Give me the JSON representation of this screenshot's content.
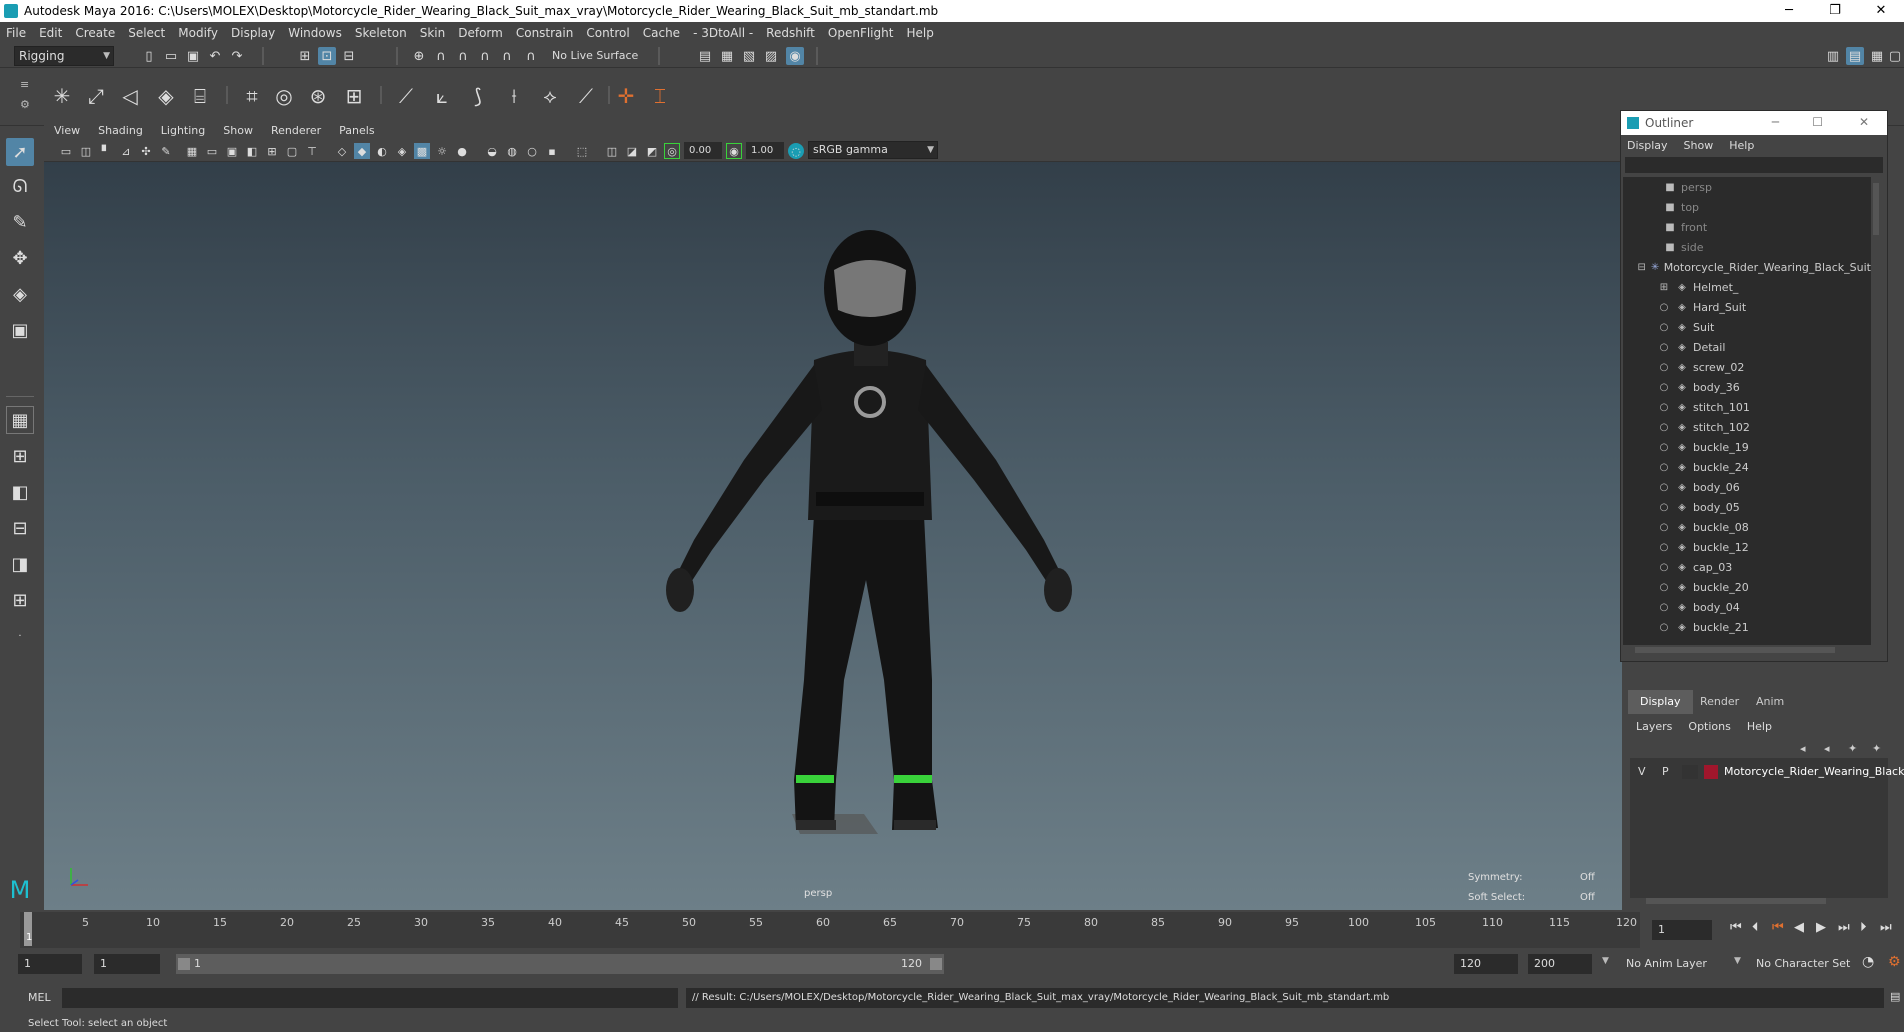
{
  "window": {
    "title": "Autodesk Maya 2016: C:\\Users\\MOLEX\\Desktop\\Motorcycle_Rider_Wearing_Black_Suit_max_vray\\Motorcycle_Rider_Wearing_Black_Suit_mb_standart.mb",
    "minimize": "─",
    "restore": "❐",
    "close": "✕"
  },
  "menubar": [
    "File",
    "Edit",
    "Create",
    "Select",
    "Modify",
    "Display",
    "Windows",
    "Skeleton",
    "Skin",
    "Deform",
    "Constrain",
    "Control",
    "Cache",
    "- 3DtoAll -",
    "Redshift",
    "OpenFlight",
    "Help"
  ],
  "statusline": {
    "menuset": "Rigging",
    "live_surface": "No Live Surface"
  },
  "viewport": {
    "menu": [
      "View",
      "Shading",
      "Lighting",
      "Show",
      "Renderer",
      "Panels"
    ],
    "exposure": "0.00",
    "gamma": "1.00",
    "color_space": "sRGB gamma",
    "camera_label": "persp",
    "symmetry_label": "Symmetry:",
    "symmetry_value": "Off",
    "soft_select_label": "Soft Select:",
    "soft_select_value": "Off"
  },
  "outliner": {
    "title": "Outliner",
    "menu": [
      "Display",
      "Show",
      "Help"
    ],
    "cameras": [
      "persp",
      "top",
      "front",
      "side"
    ],
    "root": "Motorcycle_Rider_Wearing_Black_Suit",
    "children": [
      "Helmet_",
      "Hard_Suit",
      "Suit",
      "Detail",
      "screw_02",
      "body_36",
      "stitch_101",
      "stitch_102",
      "buckle_19",
      "buckle_24",
      "body_06",
      "body_05",
      "buckle_08",
      "buckle_12",
      "cap_03",
      "buckle_20",
      "body_04",
      "buckle_21"
    ]
  },
  "layer_editor": {
    "tabs": [
      "Display",
      "Render",
      "Anim"
    ],
    "menu": [
      "Layers",
      "Options",
      "Help"
    ],
    "layer": {
      "v": "V",
      "p": "P",
      "name": "Motorcycle_Rider_Wearing_Black",
      "color": "#a0162c"
    }
  },
  "timeline": {
    "ticks": [
      "5",
      "10",
      "15",
      "20",
      "25",
      "30",
      "35",
      "40",
      "45",
      "50",
      "55",
      "60",
      "65",
      "70",
      "75",
      "80",
      "85",
      "90",
      "95",
      "100",
      "105",
      "110",
      "115",
      "120"
    ],
    "current_frame_label": "1",
    "current_frame_field": "1"
  },
  "range": {
    "start": "1",
    "playback_start": "1",
    "slider_start": "1",
    "slider_end": "120",
    "playback_end": "120",
    "end": "200",
    "anim_layer": "No Anim Layer",
    "character_set": "No Character Set"
  },
  "command": {
    "lang": "MEL",
    "result": "// Result: C:/Users/MOLEX/Desktop/Motorcycle_Rider_Wearing_Black_Suit_max_vray/Motorcycle_Rider_Wearing_Black_Suit_mb_standart.mb"
  },
  "help_line": "Select Tool: select an object",
  "colors": {
    "selected_tool": "#5285a6",
    "suit_accent": "#39d23a"
  }
}
